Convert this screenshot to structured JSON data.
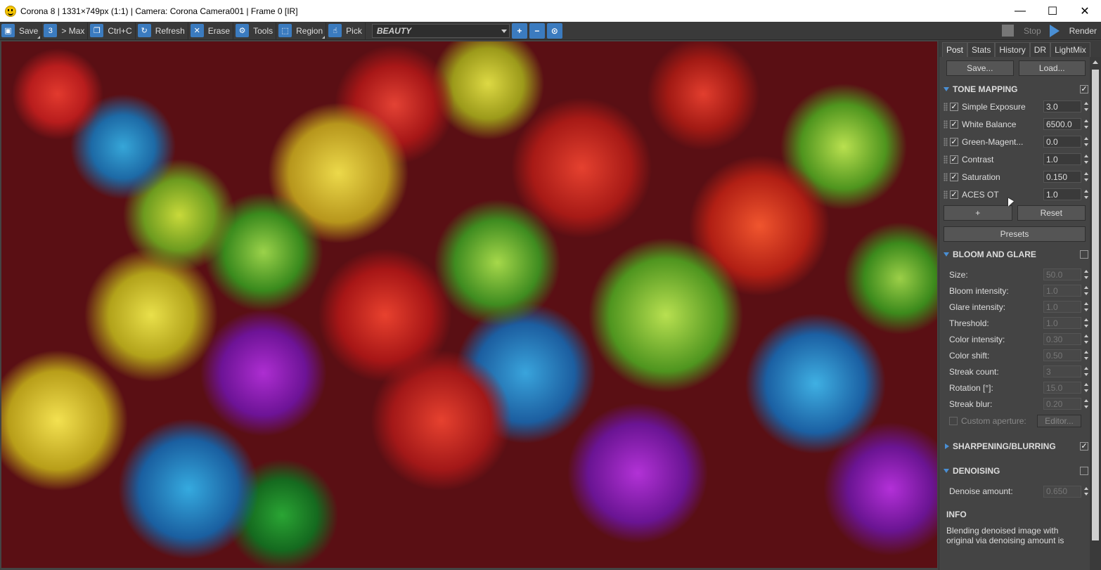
{
  "window": {
    "title": "Corona 8 | 1331×749px (1:1) | Camera: Corona Camera001 | Frame 0 [IR]",
    "minimize": "—",
    "maximize": "☐",
    "close": "✕"
  },
  "toolbar": {
    "save": "Save",
    "max": "> Max",
    "copy": "Ctrl+C",
    "refresh": "Refresh",
    "erase": "Erase",
    "tools": "Tools",
    "region": "Region",
    "pick": "Pick",
    "pass_selected": "BEAUTY",
    "stop": "Stop",
    "render": "Render"
  },
  "panel": {
    "tabs": [
      "Post",
      "Stats",
      "History",
      "DR",
      "LightMix"
    ],
    "save_button": "Save...",
    "load_button": "Load...",
    "tone_mapping": {
      "title": "TONE MAPPING",
      "enabled": true,
      "rows": [
        {
          "label": "Simple Exposure",
          "value": "3.0"
        },
        {
          "label": "White Balance",
          "value": "6500.0"
        },
        {
          "label": "Green-Magent...",
          "value": "0.0"
        },
        {
          "label": "Contrast",
          "value": "1.0"
        },
        {
          "label": "Saturation",
          "value": "0.150"
        },
        {
          "label": "ACES OT",
          "value": "1.0"
        }
      ],
      "add_button": "+",
      "reset_button": "Reset",
      "presets_button": "Presets"
    },
    "bloom_glare": {
      "title": "BLOOM AND GLARE",
      "enabled": false,
      "rows": [
        {
          "label": "Size:",
          "value": "50.0"
        },
        {
          "label": "Bloom intensity:",
          "value": "1.0"
        },
        {
          "label": "Glare intensity:",
          "value": "1.0"
        },
        {
          "label": "Threshold:",
          "value": "1.0"
        },
        {
          "label": "Color intensity:",
          "value": "0.30"
        },
        {
          "label": "Color shift:",
          "value": "0.50"
        },
        {
          "label": "Streak count:",
          "value": "3"
        },
        {
          "label": "Rotation [°]:",
          "value": "15.0"
        },
        {
          "label": "Streak blur:",
          "value": "0.20"
        }
      ],
      "custom_aperture": "Custom aperture:",
      "editor_button": "Editor..."
    },
    "sharpening": {
      "title": "SHARPENING/BLURRING",
      "enabled": true
    },
    "denoising": {
      "title": "DENOISING",
      "enabled": false,
      "amount_label": "Denoise amount:",
      "amount_value": "0.650"
    },
    "info": {
      "title": "INFO",
      "text": "Blending denoised image with original via denoising amount is"
    }
  }
}
